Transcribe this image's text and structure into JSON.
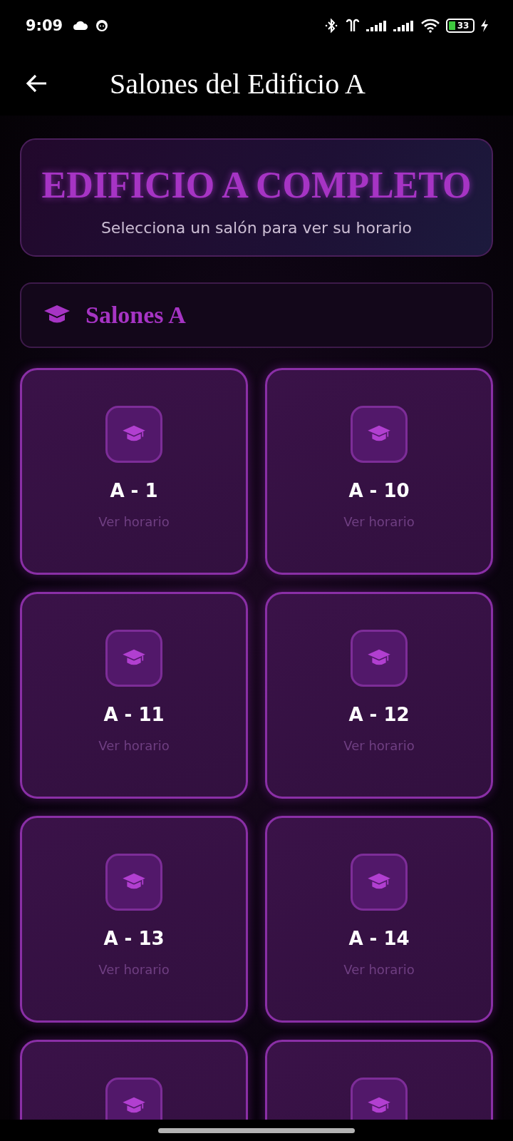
{
  "status_bar": {
    "time": "9:09",
    "battery": "33"
  },
  "header": {
    "title": "Salones del Edificio A"
  },
  "hero": {
    "title": "EDIFICIO A COMPLETO",
    "subtitle": "Selecciona un salón para ver su horario"
  },
  "section": {
    "title": "Salones A"
  },
  "rooms": [
    {
      "kind": "full",
      "name": "A - 1",
      "action": "Ver horario"
    },
    {
      "kind": "full",
      "name": "A - 10",
      "action": "Ver horario"
    },
    {
      "kind": "full",
      "name": "A - 11",
      "action": "Ver horario"
    },
    {
      "kind": "full",
      "name": "A - 12",
      "action": "Ver horario"
    },
    {
      "kind": "full",
      "name": "A - 13",
      "action": "Ver horario"
    },
    {
      "kind": "full",
      "name": "A - 14",
      "action": "Ver horario"
    },
    {
      "kind": "clipped"
    },
    {
      "kind": "clipped"
    }
  ]
}
